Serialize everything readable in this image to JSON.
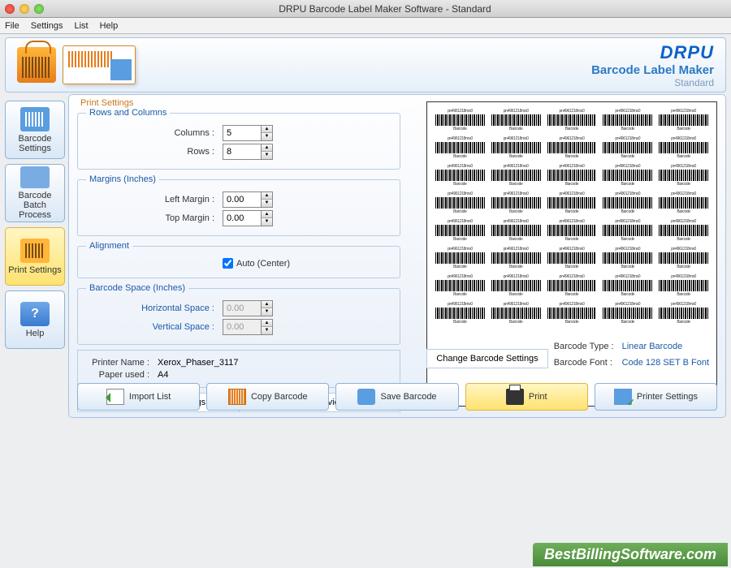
{
  "window": {
    "title": "DRPU Barcode Label Maker Software - Standard"
  },
  "menubar": [
    "File",
    "Settings",
    "List",
    "Help"
  ],
  "brand": {
    "logo": "DRPU",
    "name": "Barcode Label Maker",
    "edition": "Standard"
  },
  "sidebar": [
    {
      "label": "Barcode Settings",
      "active": false
    },
    {
      "label": "Barcode Batch Process",
      "active": false
    },
    {
      "label": "Print Settings",
      "active": true
    },
    {
      "label": "Help",
      "active": false
    }
  ],
  "panel_title": "Print Settings",
  "rows_cols": {
    "legend": "Rows and Columns",
    "columns_label": "Columns :",
    "columns_value": "5",
    "rows_label": "Rows :",
    "rows_value": "8"
  },
  "margins": {
    "legend": "Margins (Inches)",
    "left_label": "Left Margin :",
    "left_value": "0.00",
    "top_label": "Top Margin :",
    "top_value": "0.00"
  },
  "alignment": {
    "legend": "Alignment",
    "auto_label": "Auto (Center)",
    "auto_checked": true
  },
  "spacing": {
    "legend": "Barcode Space (Inches)",
    "h_label": "Horizontal Space :",
    "h_value": "0.00",
    "v_label": "Vertical Space :",
    "v_value": "0.00",
    "disabled": true
  },
  "printer": {
    "name_label": "Printer Name :",
    "name_value": "Xerox_Phaser_3117",
    "paper_label": "Paper used :",
    "paper_value": "A4",
    "change_btn": "Change Printer Settings",
    "preview_btn": "Print Preview"
  },
  "barcode_info": {
    "change_btn": "Change Barcode Settings",
    "type_label": "Barcode Type :",
    "type_value": "Linear Barcode",
    "font_label": "Barcode Font :",
    "font_value": "Code 128 SET B Font"
  },
  "actions": {
    "import": "Import List",
    "copy": "Copy Barcode",
    "save": "Save Barcode",
    "print": "Print",
    "printer_settings": "Printer Settings"
  },
  "watermark": "BestBillingSoftware.com",
  "preview": {
    "columns": 5,
    "rows": 8
  }
}
